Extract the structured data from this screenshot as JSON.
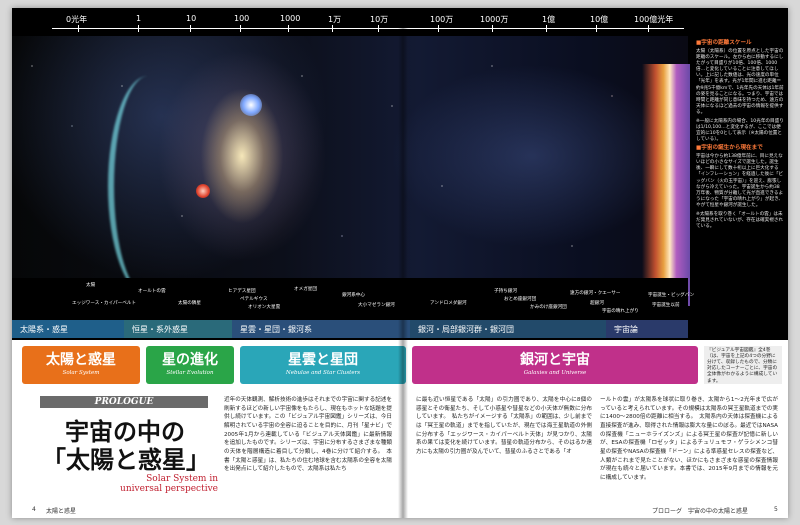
{
  "scale": {
    "ticks": [
      "0光年",
      "1",
      "10",
      "100",
      "1000",
      "1万",
      "10万",
      "100万",
      "1000万",
      "1億",
      "10億",
      "100億光年"
    ]
  },
  "objects": [
    "太陽",
    "エッジワース・カイパーベルト",
    "オールトの雲",
    "太陽の隣星",
    "ヒアデス星団",
    "ペテルギウス",
    "オリオン大星雲",
    "オメガ星団",
    "銀河系中心",
    "大小マゼラン銀河",
    "アンドロメダ銀河",
    "子持ち銀河",
    "おとめ座銀河団",
    "かみのけ座銀河団",
    "遠方の銀河・クエーサー",
    "超銀河",
    "宇宙の晴れ上がり",
    "宇宙誕生・ビッグバン",
    "宇宙誕生以前"
  ],
  "band": [
    {
      "label": "太陽系・惑星",
      "color": "#1f5f8a"
    },
    {
      "label": "恒星・系外惑星",
      "color": "#2a6a7a"
    },
    {
      "label": "星雲・星団・銀河系",
      "color": "#2a4f7a"
    },
    {
      "label": "銀河・局部銀河群・銀河団",
      "color": "#224a6a"
    },
    {
      "label": "宇宙論",
      "color": "#2a3a6a"
    }
  ],
  "sidebar": {
    "h1": "■宇宙の距離スケール",
    "p1": "太陽（太陽系）の位置を原点とした宇宙の距離のスケール。左から右に移動するにしたがって目盛りが10倍、100倍、1000倍…と変化していることに注意してほしい。上に記した数値は、光の速度の単位「光年」を表す。光が1年間に進む距離＝約9兆5千億kmで、1光年先の天体は1年前の姿を見ることになる。つまり、宇宙では時間と距離が同じ意味を持つため、遠方の天体になるほど過去の宇宙の情報を提供する。",
    "p2": "※一般に太陽系内の場合、10光年の目盛りは1/10,100…と変化するが、ここでは便宜的に10を0として表示（※太陽の位置としている）。",
    "h2": "■宇宙の誕生から現在まで",
    "p3": "宇宙は今から約138億年前に、目に見えないほどの小さなサイズで誕生した。誕生後、一瞬にして数十桁以上に巨大化する「インフレーション」を経過した後に「ビッグバン（火の玉宇宙）」を迎え、膨張しながら冷えていった。宇宙誕生から約38万年後、物質が分離して光が直進できるようになった「宇宙の晴れ上がり」が起き、やがて恒星や銀河が誕生した。",
    "p4": "※太陽系を取り巻く「オールトの雲」は未だ発見されていないが、存在は確実視されている。"
  },
  "tabs": [
    {
      "jp": "太陽と惑星",
      "en": "Solar System"
    },
    {
      "jp": "星の進化",
      "en": "Stellar Evolution"
    },
    {
      "jp": "星雲と星団",
      "en": "Nebulae and Star Clusters"
    },
    {
      "jp": "銀河と宇宙",
      "en": "Galaxies and Universe"
    }
  ],
  "note": "『ビジュアル宇宙図鑑』全4巻（は、宇宙を上記の4つの分野に分けて、収録したもので、分類に対応したコーナーごとに、宇宙の全体像がわかるように構成しています。",
  "prologue": {
    "label": "PROLOGUE",
    "title1": "宇宙の中の",
    "title2": "「太陽と惑星」",
    "subtitle": "Solar System in universal perspective"
  },
  "body": {
    "col1": "近年の天体観測、解析技術の進歩はそれまでの宇宙に関する記述を刷新するほどの新しい宇宙像をもたらし、現在もホットな話題を提供し続けています。この「ビジュアル宇宙図鑑」シリーズは、今日解明されている宇宙の全容に迫ることを目的に、月刊「星ナビ」で2005年1月から連載している「ビジュアル天体図鑑」に最新情報を追加したものです。シリーズは、宇宙に分布するさまざまな種類の天体を階層構造に着目して分類し、4巻に分けて紹介する。　本書「太陽と惑星」は、私たちの住む地球を含む太陽系の全容を太陽を出発点にして紹介したもので、太陽系は私たち",
    "col2": "に最も近い恒星である「太陽」の引力圏であり、太陽を中心に8個の惑星とその衛星たち、そして小惑星や彗星などの小天体が無数に分布しています。　私たちがイメージする「太陽系」の範囲は、少し前までは「冥王星の軌道」までを指していたが、現在では海王星軌道の外側に分布する「エッジワース・カイパーベルト天体」が見つかり、太陽系の果ては変化を続けています。彗星の軌道分布から、そのはるか遠方にも太陽の引力圏が及んでいて、彗星のふるさとである「オ",
    "col3": "ールトの雲」が太陽系を球状に取り巻き、太陽から1〜2光年まで広がっていると考えられています。その規模は太陽系の冥王星軌道までの実に1400〜2800倍の距離に相当する。　太陽系内の天体は探査機による直接探査が進み、取得された情報は膨大な量にのぼる。最近ではNASAの探査機「ニューホライズンズ」による冥王星の探査が記憶に新しいが、ESAの探査機「ロゼッタ」によるチュリュモフ・ゲラシメンコ彗星の探査やNASAの探査機「ドーン」による準惑星セレスの探査など、人類がこれまで見たことがない、ほかにもさまざまな惑星の探査情報が現在も続々と届いています。本書では、2015年9月までの情報を元に構成しています。"
  },
  "footer": {
    "left_page": "4",
    "left_title": "太陽と惑星",
    "right_title": "プロローグ　宇宙の中の太陽と惑星",
    "right_page": "5"
  }
}
